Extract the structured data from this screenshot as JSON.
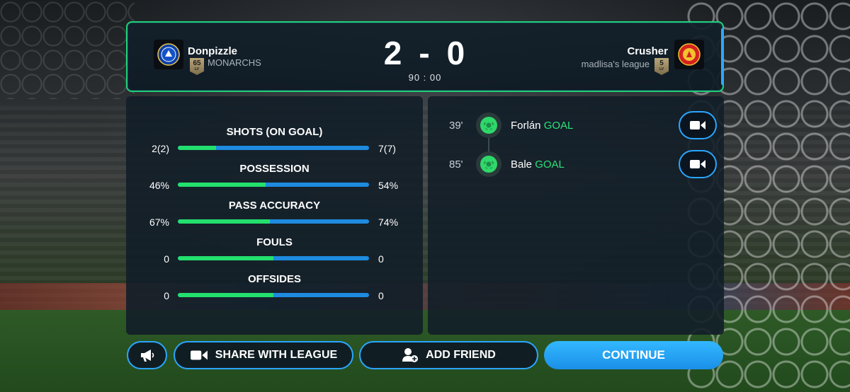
{
  "match": {
    "home": {
      "name": "Donpizzle",
      "league": "MONARCHS",
      "level": "65",
      "level_word": "LV",
      "score": "2"
    },
    "away": {
      "name": "Crusher",
      "league": "madlisa's league",
      "level": "5",
      "level_word": "LV",
      "score": "0"
    },
    "separator": "-",
    "clock": "90 : 00"
  },
  "stats": [
    {
      "title": "SHOTS (ON GOAL)",
      "home": "2(2)",
      "away": "7(7)",
      "home_share": 0.2
    },
    {
      "title": "POSSESSION",
      "home": "46%",
      "away": "54%",
      "home_share": 0.46
    },
    {
      "title": "PASS ACCURACY",
      "home": "67%",
      "away": "74%",
      "home_share": 0.48
    },
    {
      "title": "FOULS",
      "home": "0",
      "away": "0",
      "home_share": 0.5
    },
    {
      "title": "OFFSIDES",
      "home": "0",
      "away": "0",
      "home_share": 0.5
    }
  ],
  "events": [
    {
      "minute": "39'",
      "player": "Forlán",
      "type": "GOAL"
    },
    {
      "minute": "85'",
      "player": "Bale",
      "type": "GOAL"
    }
  ],
  "buttons": {
    "announce_icon": "megaphone-icon",
    "share_label": "SHARE WITH LEAGUE",
    "add_friend_label": "ADD FRIEND",
    "continue_label": "CONTINUE"
  },
  "colors": {
    "home_bar": "#23e06e",
    "away_bar": "#1e8be0",
    "accent": "#2aa6ff",
    "goal": "#2ee079"
  }
}
